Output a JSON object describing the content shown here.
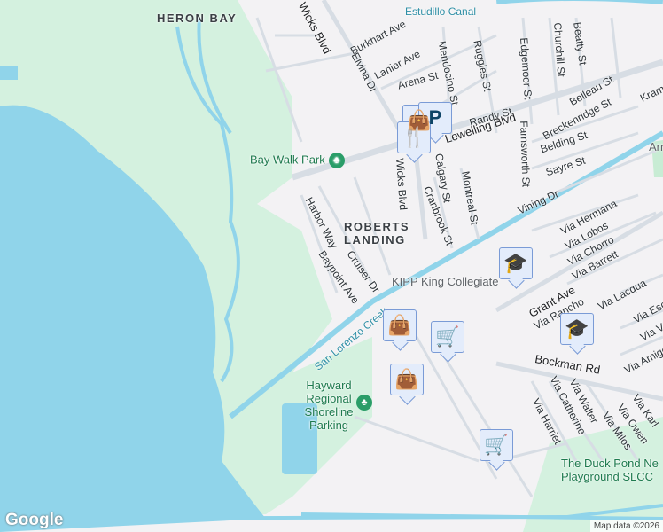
{
  "map": {
    "neighborhoods": [
      "HERON BAY",
      "ROBERTS LANDING"
    ],
    "roads": [
      "Wicks Blvd",
      "Burkhart Ave",
      "Elvina Dr",
      "Lanier Ave",
      "Arena St",
      "Mendocino St",
      "Ruggles St",
      "Edgemoor St",
      "Churchill St",
      "Beatty St",
      "Randy St",
      "Belleau St",
      "Breckenridge St",
      "Kramer",
      "Belding St",
      "Sayre St",
      "Farnsworth St",
      "Lewelling Blvd",
      "Calgary St",
      "Montreal St",
      "Cranbrook St",
      "Vining Dr",
      "Harbor Way",
      "Cruiser Dr",
      "Baypoint Ave",
      "Via Hermana",
      "Via Lobos",
      "Via Chorro",
      "Via Barrett",
      "Grant Ave",
      "Via Rancho",
      "Via Lacqua",
      "Via Esco",
      "Via Ve",
      "Via Amigos",
      "Bockman Rd",
      "Via Catherine",
      "Via Walter",
      "Via Harriet",
      "Via Karl",
      "Via Owen",
      "Via Milos",
      "Wicks Blvd"
    ],
    "water_labels": [
      "Estudillo Canal",
      "San Lorenzo Creek"
    ],
    "parks": [
      "Bay Walk Park",
      "Hayward Regional Shoreline Parking",
      "The Duck Pond Ne Playground SLCC"
    ],
    "pois": [
      "KIPP King Collegiate",
      "Arn"
    ],
    "markers": [
      {
        "type": "shopping-bag"
      },
      {
        "type": "parking"
      },
      {
        "type": "restaurant"
      },
      {
        "type": "school"
      },
      {
        "type": "shopping-bag"
      },
      {
        "type": "shopping-cart"
      },
      {
        "type": "school"
      },
      {
        "type": "shopping-bag"
      },
      {
        "type": "shopping-cart"
      }
    ],
    "logo": "Google",
    "attribution": "Map data ©2026"
  },
  "colors": {
    "land": "#f3f2f4",
    "water": "#90d4ea",
    "park": "#d4f1df",
    "road": "#d7dde4"
  }
}
